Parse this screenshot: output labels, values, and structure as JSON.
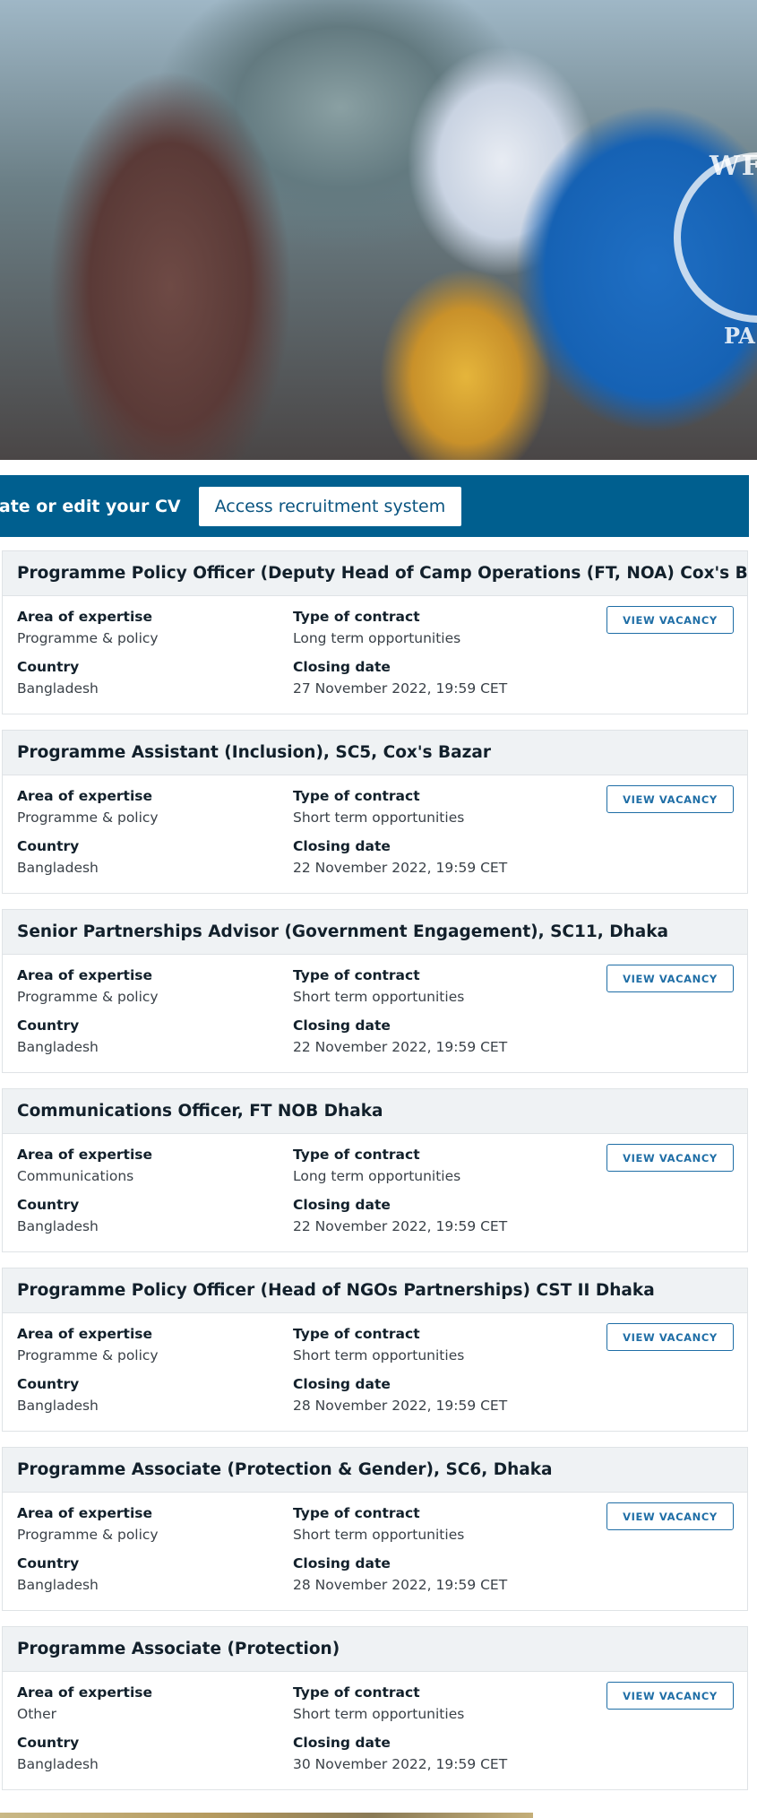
{
  "cta": {
    "create_cv_text": "eate or edit your CV",
    "access_button": "Access recruitment system"
  },
  "labels": {
    "area": "Area of expertise",
    "contract": "Type of contract",
    "country": "Country",
    "closing": "Closing date",
    "view": "VIEW VACANCY"
  },
  "jobs": [
    {
      "title": "Programme Policy Officer (Deputy Head of Camp Operations (FT, NOA) Cox's Bazar",
      "area": "Programme & policy",
      "contract": "Long term opportunities",
      "country": "Bangladesh",
      "closing": "27 November 2022, 19:59 CET"
    },
    {
      "title": "Programme Assistant (Inclusion), SC5, Cox's Bazar",
      "area": "Programme & policy",
      "contract": "Short term opportunities",
      "country": "Bangladesh",
      "closing": "22 November 2022, 19:59 CET"
    },
    {
      "title": "Senior Partnerships Advisor (Government Engagement), SC11, Dhaka",
      "area": "Programme & policy",
      "contract": "Short term opportunities",
      "country": "Bangladesh",
      "closing": "22 November 2022, 19:59 CET"
    },
    {
      "title": "Communications Officer, FT NOB Dhaka",
      "area": "Communications",
      "contract": "Long term opportunities",
      "country": "Bangladesh",
      "closing": "22 November 2022, 19:59 CET"
    },
    {
      "title": "Programme Policy Officer (Head of NGOs Partnerships) CST II Dhaka",
      "area": "Programme & policy",
      "contract": "Short term opportunities",
      "country": "Bangladesh",
      "closing": "28 November 2022, 19:59 CET"
    },
    {
      "title": "Programme Associate (Protection & Gender), SC6, Dhaka",
      "area": "Programme & policy",
      "contract": "Short term opportunities",
      "country": "Bangladesh",
      "closing": "28 November 2022, 19:59 CET"
    },
    {
      "title": "Programme Associate (Protection)",
      "area": "Other",
      "contract": "Short term opportunities",
      "country": "Bangladesh",
      "closing": "30 November 2022, 19:59 CET"
    }
  ]
}
